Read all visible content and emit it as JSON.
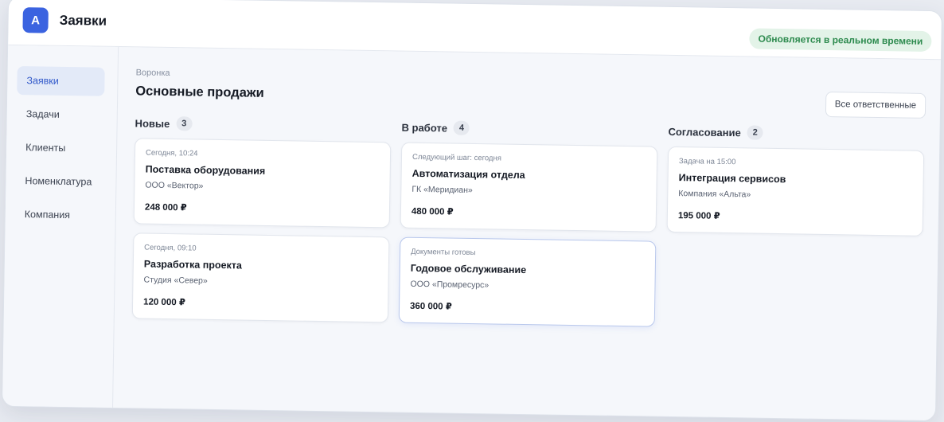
{
  "app": {
    "logo_letter": "A",
    "title": "Заявки",
    "live_status": "Обновляется в реальном времени"
  },
  "sidebar": {
    "items": [
      {
        "label": "Заявки",
        "active": true
      },
      {
        "label": "Задачи",
        "active": false
      },
      {
        "label": "Клиенты",
        "active": false
      },
      {
        "label": "Номенклатура",
        "active": false
      },
      {
        "label": "Компания",
        "active": false
      }
    ]
  },
  "main": {
    "breadcrumb": "Воронка",
    "title": "Основные продажи",
    "filter_button": "Все ответственные"
  },
  "columns": [
    {
      "title": "Новые",
      "count": "3",
      "cards": [
        {
          "meta": "Сегодня, 10:24",
          "title": "Поставка оборудования",
          "company": "ООО «Вектор»",
          "amount": "248 000 ₽"
        },
        {
          "meta": "Сегодня, 09:10",
          "title": "Разработка проекта",
          "company": "Студия «Север»",
          "amount": "120 000 ₽"
        }
      ]
    },
    {
      "title": "В работе",
      "count": "4",
      "cards": [
        {
          "meta": "Следующий шаг: сегодня",
          "title": "Автоматизация отдела",
          "company": "ГК «Меридиан»",
          "amount": "480 000 ₽"
        },
        {
          "meta": "Документы готовы",
          "title": "Годовое обслуживание",
          "company": "ООО «Промресурс»",
          "amount": "360 000 ₽"
        }
      ]
    },
    {
      "title": "Согласование",
      "count": "2",
      "cards": [
        {
          "meta": "Задача на 15:00",
          "title": "Интеграция сервисов",
          "company": "Компания «Альта»",
          "amount": "195 000 ₽"
        }
      ]
    }
  ],
  "colors": {
    "accent": "#3b63e0",
    "live_bg": "#e3f3e8",
    "live_text": "#2e8b4f"
  }
}
